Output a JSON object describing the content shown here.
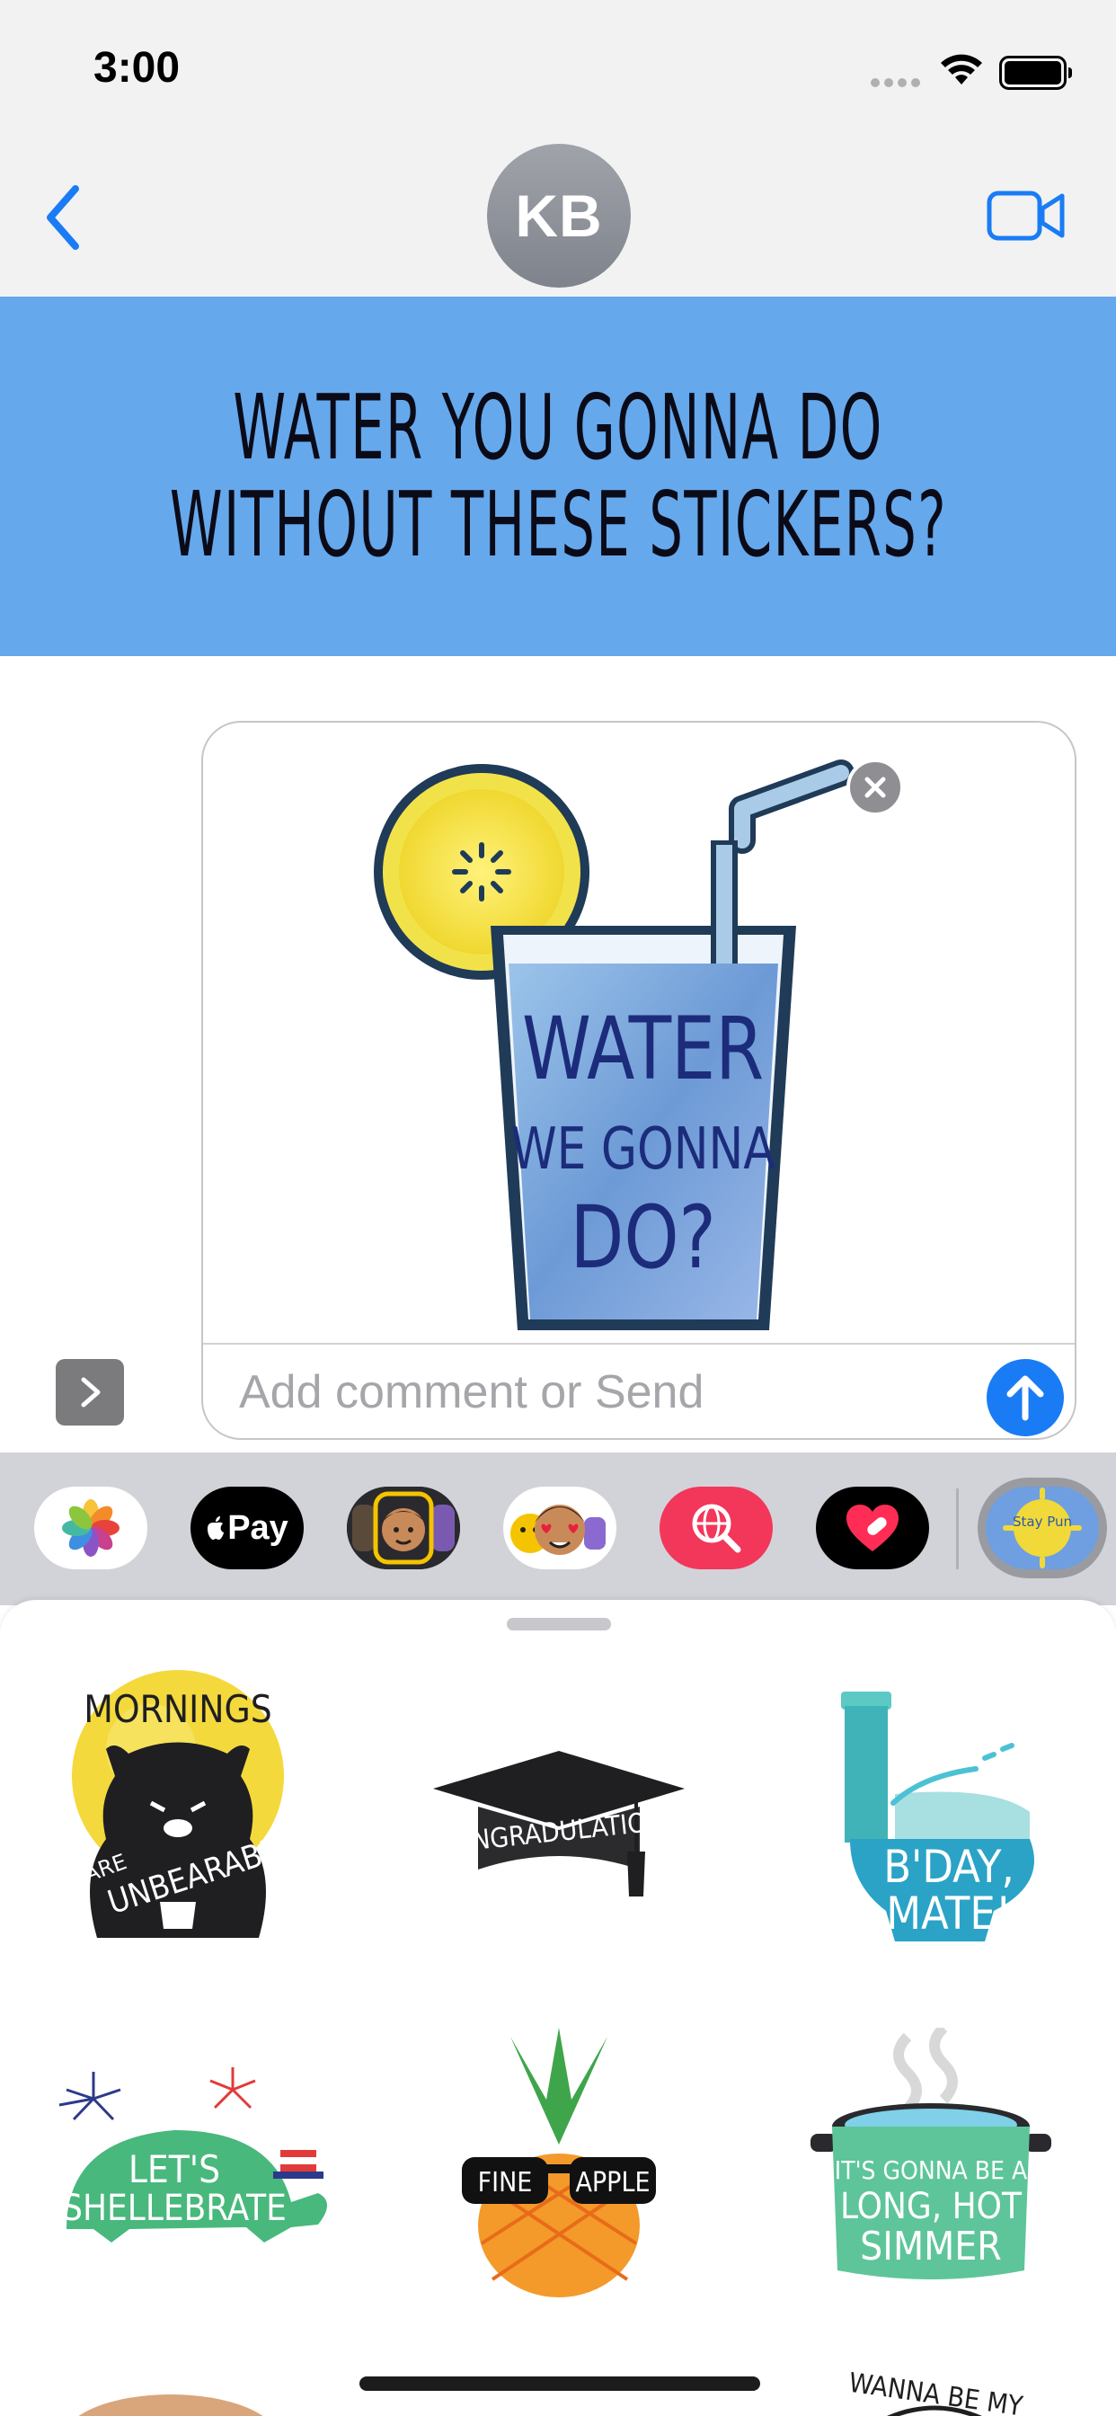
{
  "status_bar": {
    "time": "3:00"
  },
  "header": {
    "avatar_initials": "KB"
  },
  "banner": {
    "line1": "WATER YOU GONNA DO",
    "line2": "WITHOUT THESE STICKERS?"
  },
  "compose": {
    "placeholder": "Add comment or Send",
    "sticker": {
      "icon": "lemonade-glass-sticker",
      "text": [
        "WATER",
        "WE GONNA",
        "DO?"
      ]
    }
  },
  "app_drawer": {
    "items": [
      {
        "name": "photos",
        "icon": "photos-icon"
      },
      {
        "name": "apple-pay",
        "label": "Pay",
        "icon": "apple-pay-icon"
      },
      {
        "name": "memoji",
        "icon": "memoji-icon"
      },
      {
        "name": "memoji-stickers",
        "icon": "memoji-stickers-icon"
      },
      {
        "name": "images-search",
        "icon": "globe-search-icon"
      },
      {
        "name": "digital-touch",
        "icon": "heart-icon"
      },
      {
        "name": "sticker-pack",
        "label": "Stay Pun",
        "icon": "sticker-pack-icon",
        "selected": true
      }
    ]
  },
  "stickers": [
    {
      "name": "mornings-bear",
      "text": [
        "MORNINGS",
        "ARE",
        "UNBEARABLE"
      ]
    },
    {
      "name": "graduation-cap",
      "text": [
        "CONGRADULATIONS"
      ]
    },
    {
      "name": "bday-toilet",
      "text": [
        "B'DAY,",
        "MATE!"
      ]
    },
    {
      "name": "turtle",
      "text": [
        "LET'S",
        "SHELLEBRATE"
      ]
    },
    {
      "name": "pineapple",
      "text": [
        "FINE",
        "APPLE"
      ]
    },
    {
      "name": "simmer-pot",
      "text": [
        "IT'S GONNA BE A",
        "LONG, HOT",
        "SIMMER"
      ]
    },
    {
      "name": "partial-sticker-left",
      "text": []
    },
    {
      "name": "partial-sticker-right",
      "text": [
        "WANNA BE MY"
      ]
    }
  ],
  "colors": {
    "banner_bg": "#66a8ec",
    "accent_blue": "#1a7cf5",
    "drawer_bg": "#d2d3d8"
  }
}
